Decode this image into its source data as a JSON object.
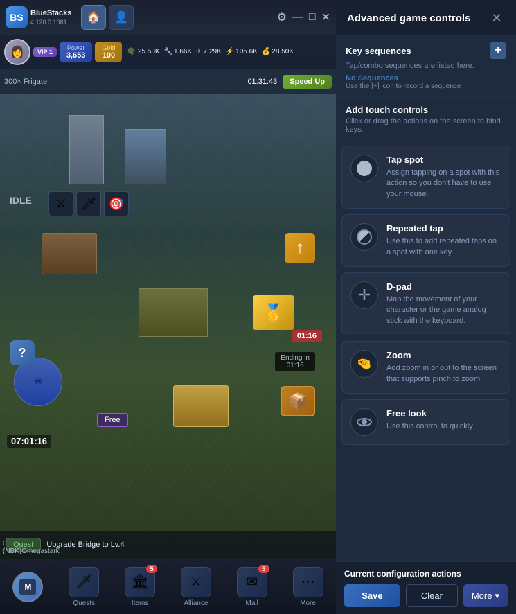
{
  "app": {
    "name": "BlueStacks",
    "version": "4.120.0.1081"
  },
  "topbar": {
    "controls": [
      "⚙",
      "—",
      "□",
      "✕"
    ]
  },
  "hud": {
    "vip": "VIP 1",
    "power_label": "Power",
    "power_value": "3,653",
    "gold_label": "Gold",
    "gold_value": "100",
    "resources": [
      {
        "icon": "🪖",
        "value": "25.53K"
      },
      {
        "icon": "🔧",
        "value": "1.66K"
      },
      {
        "icon": "✈",
        "value": "7.29K"
      },
      {
        "icon": "⚡",
        "value": "105.6K"
      },
      {
        "icon": "💰",
        "value": "28.50K"
      }
    ]
  },
  "unit_bar": {
    "name": "300× Frigate",
    "timer": "01:31:43",
    "speed_up": "Speed Up"
  },
  "map": {
    "idle_label": "IDLE",
    "big_clock": "07:01:16",
    "timer_badge": "01:16",
    "ending_label": "Ending in",
    "ending_time": "01:16",
    "free_label": "Free"
  },
  "quest_bar": {
    "quest_btn": "Quest",
    "quest_text": "Upgrade Bridge to Lv.4"
  },
  "bottom_nav": {
    "items": [
      {
        "icon": "M",
        "label": ""
      },
      {
        "icon": "🗡",
        "label": "Quests",
        "badge": ""
      },
      {
        "icon": "🏛",
        "label": "Items",
        "badge": "5"
      },
      {
        "icon": "⚔",
        "label": "Alliance",
        "badge": ""
      },
      {
        "icon": "✉",
        "label": "Mail",
        "badge": "5"
      },
      {
        "icon": "…",
        "label": "More",
        "badge": ""
      }
    ],
    "player_name": "(NBK)Omegastark",
    "player_power": "0"
  },
  "panel": {
    "title": "Advanced game controls",
    "close_icon": "✕",
    "sections": {
      "key_sequences": {
        "title": "Key sequences",
        "subtitle": "Tap/combo sequences are listed here.",
        "no_sequences": "No Sequences",
        "hint": "Use the [+] icon to record a sequence",
        "plus_label": "+"
      },
      "touch_controls": {
        "title": "Add touch controls",
        "subtitle": "Click or drag the actions on the screen to bind keys."
      }
    },
    "controls": [
      {
        "id": "tap-spot",
        "title": "Tap spot",
        "description": "Assign tapping on a spot with this action so you don't have to use your mouse.",
        "icon_type": "circle"
      },
      {
        "id": "repeated-tap",
        "title": "Repeated tap",
        "description": "Use this to add repeated taps on a spot with one key",
        "icon_type": "circle-half"
      },
      {
        "id": "d-pad",
        "title": "D-pad",
        "description": "Map the movement of your character or the game analog stick with the keyboard.",
        "icon_type": "dpad"
      },
      {
        "id": "zoom",
        "title": "Zoom",
        "description": "Add zoom in or out to the screen that supports pinch to zoom",
        "icon_type": "zoom"
      },
      {
        "id": "free-look",
        "title": "Free look",
        "description": "Use this control to quickly",
        "icon_type": "eye"
      }
    ],
    "footer": {
      "title": "Current configuration actions",
      "save_label": "Save",
      "clear_label": "Clear",
      "more_label": "More",
      "more_chevron": "▾"
    }
  }
}
